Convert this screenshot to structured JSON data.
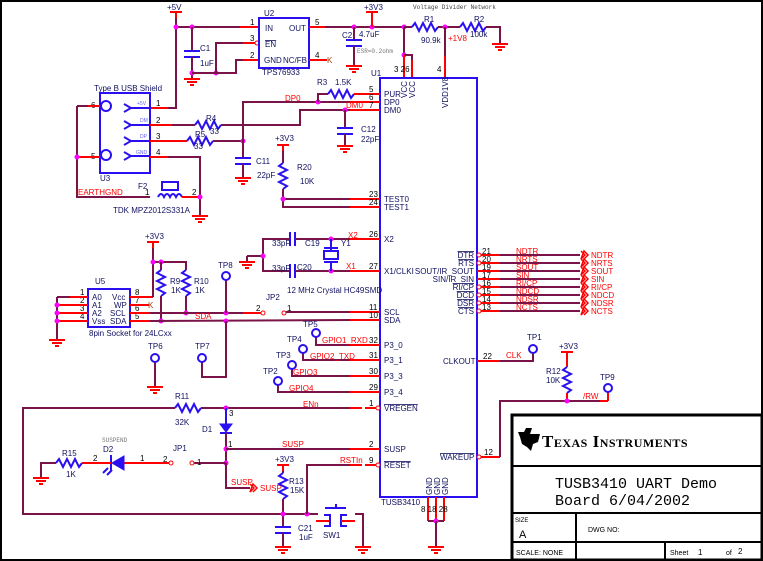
{
  "power": {
    "p5v": "+5V",
    "p3v3": "+3V3"
  },
  "u2": {
    "ref": "U2",
    "part": "TPS76933",
    "in": "IN",
    "en": "EN",
    "gnd": "GND",
    "out": "OUT",
    "ncfb": "NC/FB",
    "pin_in": "1",
    "pin_en": "3",
    "pin_gnd": "2",
    "pin_out": "5",
    "pin_ncfb": "4"
  },
  "c1": {
    "ref": "C1",
    "value": "1uF"
  },
  "c2": {
    "ref": "C2",
    "value": "4.7uF",
    "note": "ESR=0.2ohm"
  },
  "divider": {
    "title": "Voltage Divider Network",
    "r1": "R1",
    "r1_value": "90.9k",
    "r2": "R2",
    "r2_value": "100k",
    "net": "+1V8"
  },
  "u3": {
    "title": "Type B USB Shield",
    "ref": "U3",
    "l5v": "+5V",
    "ldm": "DM",
    "ldp": "DP",
    "lgnd": "GND",
    "p1": "1",
    "p2": "2",
    "p3": "3",
    "p4": "4",
    "p5": "5",
    "p6": "6"
  },
  "earth": {
    "net": "EARTHGND",
    "f2": "F2",
    "f2_part": "TDK MPZ2012S331A",
    "p1": "1",
    "p2": "2"
  },
  "usbpass": {
    "r4": "R4",
    "r4_value": "33",
    "r5": "R5",
    "r5_value": "33",
    "r3": "R3",
    "r3_value": "1.5K",
    "dp0": "DP0",
    "dm0": "DM0",
    "c11": "C11",
    "c11_value": "22pF",
    "c12": "C12",
    "c12_value": "22pF",
    "r20": "R20",
    "r20_value": "10K"
  },
  "u1": {
    "ref": "U1",
    "part": "TUSB3410",
    "vcc": "VCC",
    "vdd": "VDD1V8",
    "vcc_pins": "3  26",
    "vdd_pin": "4",
    "left": [
      {
        "num": "5",
        "name": "PUR"
      },
      {
        "num": "6",
        "name": "DP0"
      },
      {
        "num": "7",
        "name": "DM0"
      },
      {
        "num": "23",
        "name": "TEST0"
      },
      {
        "num": "24",
        "name": "TEST1"
      },
      {
        "num": "26",
        "name": "X2"
      },
      {
        "num": "27",
        "name": "X1/CLKI"
      },
      {
        "num": "11",
        "name": "SCL"
      },
      {
        "num": "10",
        "name": "SDA"
      },
      {
        "num": "32",
        "name": "P3_0"
      },
      {
        "num": "31",
        "name": "P3_1"
      },
      {
        "num": "30",
        "name": "P3_3"
      },
      {
        "num": "29",
        "name": "P3_4"
      },
      {
        "num": "1",
        "name": "VREGEN"
      },
      {
        "num": "2",
        "name": "SUSP"
      },
      {
        "num": "9",
        "name": "RESET"
      }
    ],
    "right": [
      {
        "num": "21",
        "name": "DTR",
        "net": "NDTR"
      },
      {
        "num": "20",
        "name": "RTS",
        "net": "NRTS"
      },
      {
        "num": "19",
        "name": "SOUT/IR_SOUT",
        "net": "SOUT"
      },
      {
        "num": "17",
        "name": "SIN/IR_SIN",
        "net": "SIN"
      },
      {
        "num": "16",
        "name": "RI/CP",
        "net": "RI/CP"
      },
      {
        "num": "15",
        "name": "DCD",
        "net": "NDCD"
      },
      {
        "num": "14",
        "name": "DSR",
        "net": "NDSR"
      },
      {
        "num": "13",
        "name": "CTS",
        "net": "NCTS"
      }
    ],
    "clkout": {
      "num": "22",
      "name": "CLKOUT"
    },
    "wakeup": {
      "num": "12",
      "name": "WAKEUP"
    },
    "gnd": {
      "name": "GND",
      "nums": "8 18 28"
    }
  },
  "crystal": {
    "c19": "C19",
    "c19_value": "33pF",
    "c20": "C20",
    "c20_value": "33pF",
    "y1": "Y1",
    "desc": "12 MHz Crystal HC49SMD",
    "x1": "X1",
    "x2": "X2"
  },
  "u5": {
    "ref": "U5",
    "a0": "A0",
    "a1": "A1",
    "a2": "A2",
    "vss": "Vss",
    "vcc": "Vcc",
    "wp": "WP",
    "scl": "SCL",
    "sda": "SDA",
    "desc": "8pin Socket for 24LCxx",
    "pins_left": [
      "1",
      "2",
      "3",
      "4"
    ],
    "pins_right": [
      "8",
      "7",
      "6",
      "5"
    ]
  },
  "i2c": {
    "r9": "R9",
    "r9_value": "1K",
    "r10": "R10",
    "r10_value": "1K",
    "tp8": "TP8",
    "tp6": "TP6",
    "tp7": "TP7",
    "jp2": "JP2",
    "jp2_p1": "1",
    "jp2_p2": "2",
    "sda": "SDA"
  },
  "gpio": {
    "tp5": "TP5",
    "n1": "GPIO1_RXD",
    "tp4": "TP4",
    "n2": "GPIO2_TXD",
    "tp3": "TP3",
    "n3": "GPIO3",
    "tp2": "TP2",
    "n4": "GPIO4"
  },
  "bottom": {
    "r11": "R11",
    "r11_value": "32K",
    "enn": "ENn",
    "d1": "D1",
    "d1_p3": "3",
    "d1_p1": "1",
    "susp": "SUSP",
    "d2": "D2",
    "d2_label": "SUSPEND",
    "d2_p1": "1",
    "d2_p2": "2",
    "r15": "R15",
    "r15_value": "1K",
    "jp1": "JP1",
    "jp1_p1": "1",
    "jp1_p2": "2",
    "susp_off": "SUSP",
    "susp_off2": "SUSP",
    "r13": "R13",
    "r13_value": "15K",
    "rstin": "RSTIn",
    "c21": "C21",
    "c21_value": "1uF",
    "sw1": "SW1"
  },
  "rightside": {
    "tp1": "TP1",
    "clk": "CLK",
    "r12": "R12",
    "r12_value": "10K",
    "tp9": "TP9",
    "rw": "/RW"
  },
  "titleblock": {
    "company": "Texas Instruments",
    "title1": "TUSB3410 UART Demo",
    "title2": "Board 6/04/2002",
    "size_label": "SIZE",
    "size": "A",
    "dwg_label": "DWG NO:",
    "scale": "SCALE: NONE",
    "sheet_label": "Sheet",
    "sheet": "1",
    "of_label": "of",
    "of": "2"
  },
  "colors": {
    "wire": "#7a1448",
    "pin": "#ff0000",
    "component": "#2a10f0",
    "junction": "#ff00ff",
    "net_label": "#ff0000"
  }
}
